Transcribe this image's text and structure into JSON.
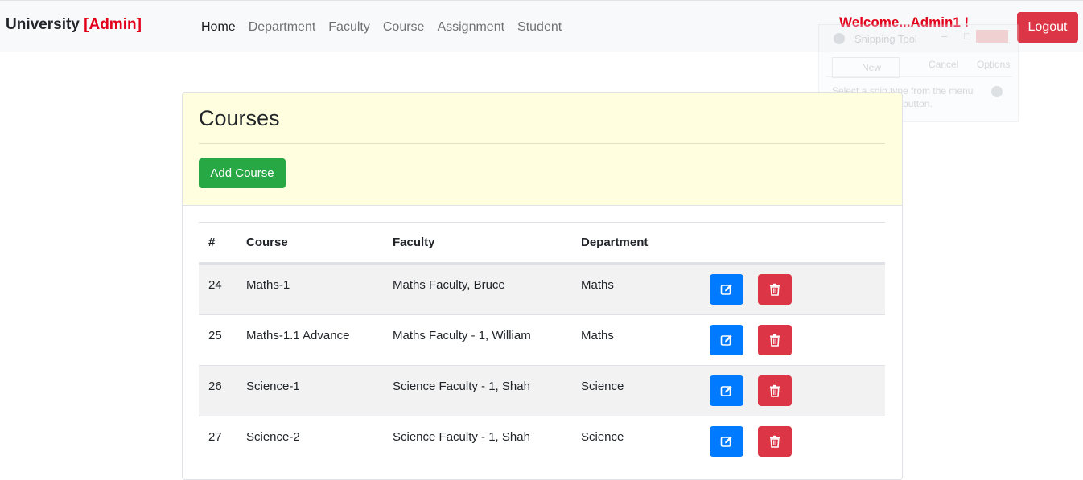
{
  "navbar": {
    "brand": "University",
    "role": "[Admin]",
    "links": [
      "Home",
      "Department",
      "Faculty",
      "Course",
      "Assignment",
      "Student"
    ],
    "welcome": "Welcome...Admin1 !",
    "logout_label": "Logout"
  },
  "ghost_window": {
    "title": "Snipping Tool",
    "new_label": "New",
    "cancel_label": "Cancel",
    "options_label": "Options",
    "message": "Select a snip type from the menu or click the New button."
  },
  "courses": {
    "title": "Courses",
    "add_label": "Add Course",
    "columns": [
      "#",
      "Course",
      "Faculty",
      "Department"
    ],
    "rows": [
      {
        "id": "24",
        "course": "Maths-1",
        "faculty": "Maths Faculty, Bruce",
        "department": "Maths"
      },
      {
        "id": "25",
        "course": "Maths-1.1 Advance",
        "faculty": "Maths Faculty - 1, William",
        "department": "Maths"
      },
      {
        "id": "26",
        "course": "Science-1",
        "faculty": "Science Faculty - 1, Shah",
        "department": "Science"
      },
      {
        "id": "27",
        "course": "Science-2",
        "faculty": "Science Faculty - 1, Shah",
        "department": "Science"
      }
    ]
  },
  "colors": {
    "primary": "#007bff",
    "danger": "#dc3545",
    "success": "#28a745",
    "header_bg": "#ffffdf",
    "accent_red": "#e3001b"
  },
  "icons": {
    "edit": "pencil-square-icon",
    "delete": "trash-icon"
  }
}
